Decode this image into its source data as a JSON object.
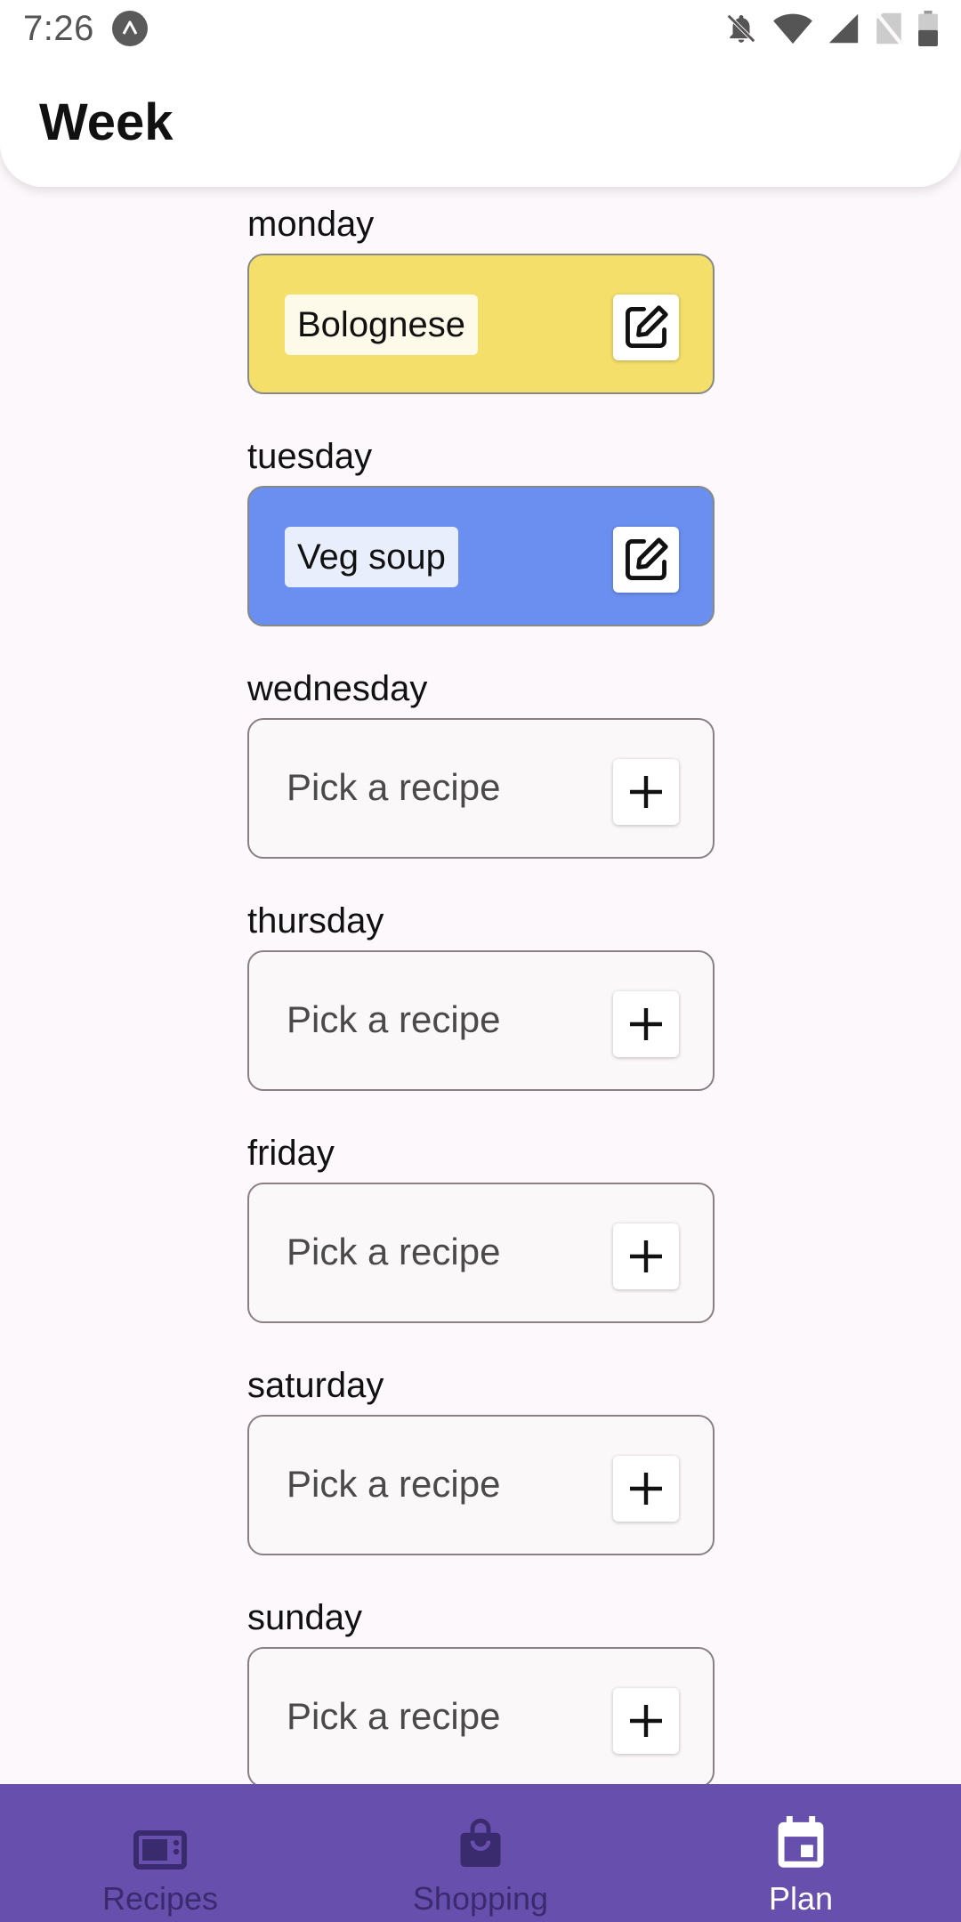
{
  "status_bar": {
    "time": "7:26"
  },
  "header": {
    "title": "Week"
  },
  "days": [
    {
      "label": "monday",
      "recipe": "Bolognese",
      "placeholder": "",
      "color": "#f4df6a",
      "action": "edit"
    },
    {
      "label": "tuesday",
      "recipe": "Veg soup",
      "placeholder": "",
      "color": "#6b8ff0",
      "action": "edit"
    },
    {
      "label": "wednesday",
      "recipe": "",
      "placeholder": "Pick a recipe",
      "color": "#fbf8fa",
      "action": "add"
    },
    {
      "label": "thursday",
      "recipe": "",
      "placeholder": "Pick a recipe",
      "color": "#fbf8fa",
      "action": "add"
    },
    {
      "label": "friday",
      "recipe": "",
      "placeholder": "Pick a recipe",
      "color": "#fbf8fa",
      "action": "add"
    },
    {
      "label": "saturday",
      "recipe": "",
      "placeholder": "Pick a recipe",
      "color": "#fbf8fa",
      "action": "add"
    },
    {
      "label": "sunday",
      "recipe": "",
      "placeholder": "Pick a recipe",
      "color": "#fbf8fa",
      "action": "add"
    }
  ],
  "nav": {
    "items": [
      {
        "label": "Recipes",
        "icon": "microwave-icon",
        "active": false
      },
      {
        "label": "Shopping",
        "icon": "shopping-bag-icon",
        "active": false
      },
      {
        "label": "Plan",
        "icon": "calendar-icon",
        "active": true
      }
    ]
  },
  "colors": {
    "nav_background": "#6750ad",
    "nav_inactive": "#3a2a6e",
    "nav_active": "#ffffff",
    "monday_card": "#f4df6a",
    "tuesday_card": "#6b8ff0"
  }
}
